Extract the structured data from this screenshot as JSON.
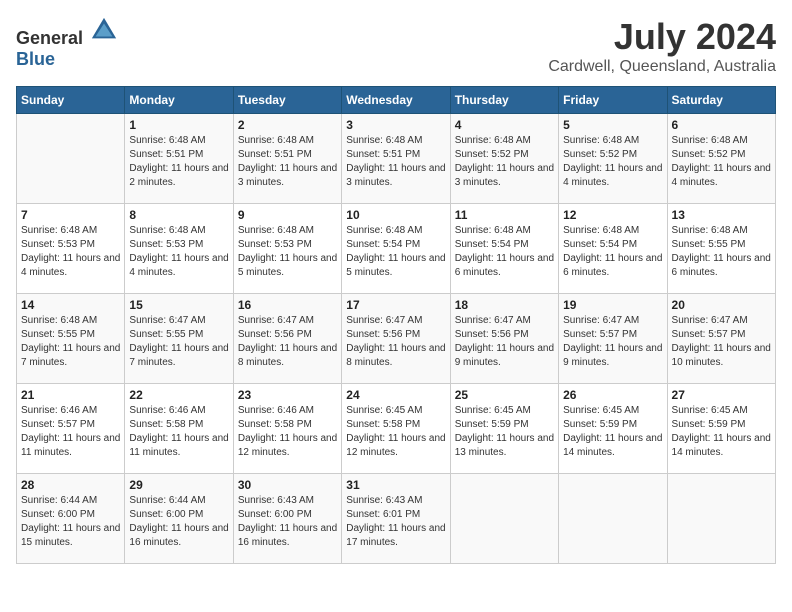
{
  "header": {
    "logo_general": "General",
    "logo_blue": "Blue",
    "month_title": "July 2024",
    "location": "Cardwell, Queensland, Australia"
  },
  "columns": [
    "Sunday",
    "Monday",
    "Tuesday",
    "Wednesday",
    "Thursday",
    "Friday",
    "Saturday"
  ],
  "weeks": [
    [
      {
        "day": "",
        "info": ""
      },
      {
        "day": "1",
        "info": "Sunrise: 6:48 AM\nSunset: 5:51 PM\nDaylight: 11 hours and 2 minutes."
      },
      {
        "day": "2",
        "info": "Sunrise: 6:48 AM\nSunset: 5:51 PM\nDaylight: 11 hours and 3 minutes."
      },
      {
        "day": "3",
        "info": "Sunrise: 6:48 AM\nSunset: 5:51 PM\nDaylight: 11 hours and 3 minutes."
      },
      {
        "day": "4",
        "info": "Sunrise: 6:48 AM\nSunset: 5:52 PM\nDaylight: 11 hours and 3 minutes."
      },
      {
        "day": "5",
        "info": "Sunrise: 6:48 AM\nSunset: 5:52 PM\nDaylight: 11 hours and 4 minutes."
      },
      {
        "day": "6",
        "info": "Sunrise: 6:48 AM\nSunset: 5:52 PM\nDaylight: 11 hours and 4 minutes."
      }
    ],
    [
      {
        "day": "7",
        "info": "Sunrise: 6:48 AM\nSunset: 5:53 PM\nDaylight: 11 hours and 4 minutes."
      },
      {
        "day": "8",
        "info": "Sunrise: 6:48 AM\nSunset: 5:53 PM\nDaylight: 11 hours and 4 minutes."
      },
      {
        "day": "9",
        "info": "Sunrise: 6:48 AM\nSunset: 5:53 PM\nDaylight: 11 hours and 5 minutes."
      },
      {
        "day": "10",
        "info": "Sunrise: 6:48 AM\nSunset: 5:54 PM\nDaylight: 11 hours and 5 minutes."
      },
      {
        "day": "11",
        "info": "Sunrise: 6:48 AM\nSunset: 5:54 PM\nDaylight: 11 hours and 6 minutes."
      },
      {
        "day": "12",
        "info": "Sunrise: 6:48 AM\nSunset: 5:54 PM\nDaylight: 11 hours and 6 minutes."
      },
      {
        "day": "13",
        "info": "Sunrise: 6:48 AM\nSunset: 5:55 PM\nDaylight: 11 hours and 6 minutes."
      }
    ],
    [
      {
        "day": "14",
        "info": "Sunrise: 6:48 AM\nSunset: 5:55 PM\nDaylight: 11 hours and 7 minutes."
      },
      {
        "day": "15",
        "info": "Sunrise: 6:47 AM\nSunset: 5:55 PM\nDaylight: 11 hours and 7 minutes."
      },
      {
        "day": "16",
        "info": "Sunrise: 6:47 AM\nSunset: 5:56 PM\nDaylight: 11 hours and 8 minutes."
      },
      {
        "day": "17",
        "info": "Sunrise: 6:47 AM\nSunset: 5:56 PM\nDaylight: 11 hours and 8 minutes."
      },
      {
        "day": "18",
        "info": "Sunrise: 6:47 AM\nSunset: 5:56 PM\nDaylight: 11 hours and 9 minutes."
      },
      {
        "day": "19",
        "info": "Sunrise: 6:47 AM\nSunset: 5:57 PM\nDaylight: 11 hours and 9 minutes."
      },
      {
        "day": "20",
        "info": "Sunrise: 6:47 AM\nSunset: 5:57 PM\nDaylight: 11 hours and 10 minutes."
      }
    ],
    [
      {
        "day": "21",
        "info": "Sunrise: 6:46 AM\nSunset: 5:57 PM\nDaylight: 11 hours and 11 minutes."
      },
      {
        "day": "22",
        "info": "Sunrise: 6:46 AM\nSunset: 5:58 PM\nDaylight: 11 hours and 11 minutes."
      },
      {
        "day": "23",
        "info": "Sunrise: 6:46 AM\nSunset: 5:58 PM\nDaylight: 11 hours and 12 minutes."
      },
      {
        "day": "24",
        "info": "Sunrise: 6:45 AM\nSunset: 5:58 PM\nDaylight: 11 hours and 12 minutes."
      },
      {
        "day": "25",
        "info": "Sunrise: 6:45 AM\nSunset: 5:59 PM\nDaylight: 11 hours and 13 minutes."
      },
      {
        "day": "26",
        "info": "Sunrise: 6:45 AM\nSunset: 5:59 PM\nDaylight: 11 hours and 14 minutes."
      },
      {
        "day": "27",
        "info": "Sunrise: 6:45 AM\nSunset: 5:59 PM\nDaylight: 11 hours and 14 minutes."
      }
    ],
    [
      {
        "day": "28",
        "info": "Sunrise: 6:44 AM\nSunset: 6:00 PM\nDaylight: 11 hours and 15 minutes."
      },
      {
        "day": "29",
        "info": "Sunrise: 6:44 AM\nSunset: 6:00 PM\nDaylight: 11 hours and 16 minutes."
      },
      {
        "day": "30",
        "info": "Sunrise: 6:43 AM\nSunset: 6:00 PM\nDaylight: 11 hours and 16 minutes."
      },
      {
        "day": "31",
        "info": "Sunrise: 6:43 AM\nSunset: 6:01 PM\nDaylight: 11 hours and 17 minutes."
      },
      {
        "day": "",
        "info": ""
      },
      {
        "day": "",
        "info": ""
      },
      {
        "day": "",
        "info": ""
      }
    ]
  ]
}
